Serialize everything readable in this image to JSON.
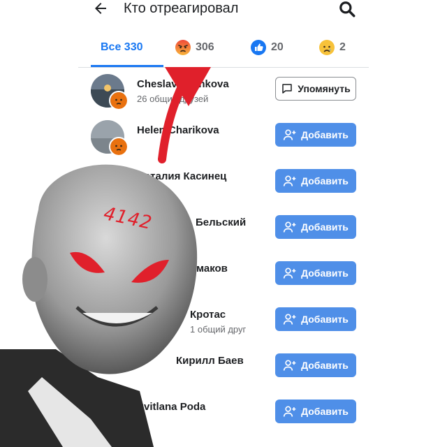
{
  "header": {
    "title": "Кто отреагировал"
  },
  "tabs": [
    {
      "label": "Все 330",
      "active": true
    },
    {
      "emoji": "angry",
      "count": "306"
    },
    {
      "emoji": "like",
      "count": "20"
    },
    {
      "emoji": "sad",
      "count": "2"
    }
  ],
  "rows": [
    {
      "name": "Cheslava Slinkova",
      "sub": "26 общих друзей",
      "action": "Упомянуть",
      "reaction": "angry"
    },
    {
      "name": "Helen Charikova",
      "sub": "",
      "action": "Добавить",
      "reaction": "angry"
    },
    {
      "name": "Наталия Касинец",
      "sub": "",
      "action": "Добавить",
      "reaction": "angry"
    },
    {
      "name": "Бельский",
      "sub": "",
      "action": "Добавить",
      "reaction": "angry"
    },
    {
      "name": "Ермаков",
      "sub": "",
      "action": "Добавить",
      "reaction": "angry"
    },
    {
      "name": "Кротас",
      "sub": "1 общий друг",
      "action": "Добавить",
      "reaction": "angry"
    },
    {
      "name": "Кирилл Баев",
      "sub": "",
      "action": "Добавить",
      "reaction": "angry"
    },
    {
      "name": "Svitlana Poda",
      "sub": "",
      "action": "Добавить",
      "reaction": "angry"
    }
  ],
  "overlay": {
    "handwritten_text": "4142"
  },
  "colors": {
    "accent": "#1877f2",
    "button": "#4f8fe8",
    "angry": "#e9710f",
    "overlay_red": "#e0202b"
  }
}
